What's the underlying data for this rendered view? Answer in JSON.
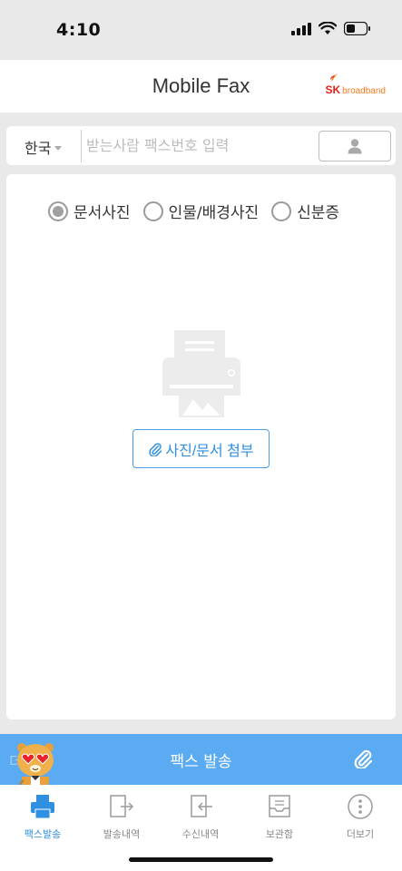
{
  "status_bar": {
    "time": "4:10"
  },
  "header": {
    "title": "Mobile Fax",
    "brand_sk": "SK",
    "brand_name": "broadband"
  },
  "recipient": {
    "country": "한국",
    "fax_placeholder": "받는사람 팩스번호 입력",
    "fax_value": ""
  },
  "document_types": [
    {
      "label": "문서사진",
      "selected": true
    },
    {
      "label": "인물/배경사진",
      "selected": false
    },
    {
      "label": "신분증",
      "selected": false
    }
  ],
  "attach_button_label": "사진/문서 첨부",
  "send_bar": {
    "ghost_text": "더보기",
    "label": "팩스 발송"
  },
  "tabs": [
    {
      "label": "팩스발송",
      "icon": "printer-icon",
      "active": true
    },
    {
      "label": "발송내역",
      "icon": "send-history-icon",
      "active": false
    },
    {
      "label": "수신내역",
      "icon": "receive-history-icon",
      "active": false
    },
    {
      "label": "보관함",
      "icon": "storage-box-icon",
      "active": false
    },
    {
      "label": "더보기",
      "icon": "more-icon",
      "active": false
    }
  ],
  "colors": {
    "accent": "#5aabf2",
    "active_tab": "#2f8fe0",
    "brand_red": "#e2231a",
    "brand_orange": "#f47a20"
  }
}
